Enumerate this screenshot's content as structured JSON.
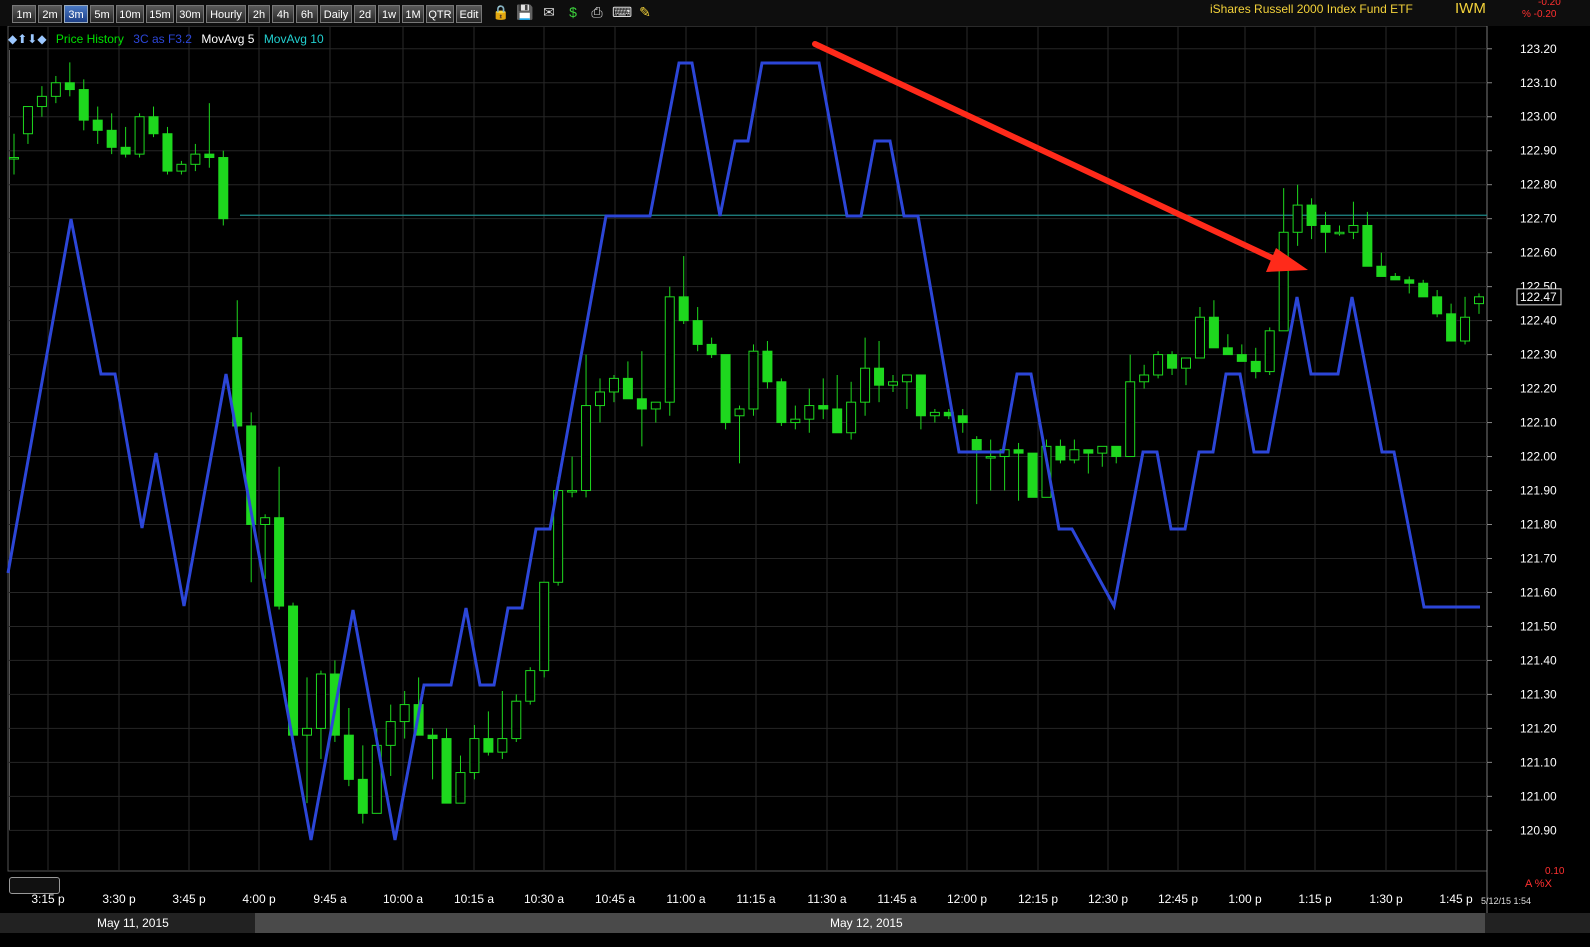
{
  "toolbar": {
    "timeframes": [
      "1m",
      "2m",
      "3m",
      "5m",
      "10m",
      "15m",
      "30m",
      "Hourly",
      "2h",
      "4h",
      "6h",
      "Daily",
      "2d",
      "1w",
      "1M",
      "QTR",
      "Edit"
    ],
    "active": "3m",
    "icons": [
      "lock-icon",
      "save-icon",
      "mail-icon",
      "dollar-icon",
      "print-icon",
      "keyboard-icon",
      "pencil-icon"
    ]
  },
  "header": {
    "title": "iShares Russell 2000 Index Fund ETF",
    "ticker": "IWM",
    "change": "-0.20",
    "change_pct": "% -0.20"
  },
  "legend": {
    "arrows": "◆⬆⬇◆",
    "items": [
      {
        "label": "Price History",
        "color": "#00e000"
      },
      {
        "label": "3C as F3.2",
        "color": "#2c46d8"
      },
      {
        "label": "MovAvg 5",
        "color": "#ffffff"
      },
      {
        "label": "MovAvg 10",
        "color": "#22d0d0"
      }
    ]
  },
  "footer": {
    "date_left": "May 11, 2015",
    "date_right": "May 12, 2015",
    "timestamp": "5/12/15 1:54",
    "right_values": [
      "0.10",
      "A %X"
    ]
  },
  "chart_data": {
    "type": "candlestick",
    "title": "iShares Russell 2000 Index Fund ETF",
    "ylim": [
      120.82,
      123.25
    ],
    "y_ticks": [
      120.9,
      121.0,
      121.1,
      121.2,
      121.3,
      121.4,
      121.5,
      121.6,
      121.7,
      121.8,
      121.9,
      122.0,
      122.1,
      122.2,
      122.3,
      122.4,
      122.5,
      122.6,
      122.7,
      122.8,
      122.9,
      123.0,
      123.1,
      123.2
    ],
    "last_price": "122.47",
    "reference_line": 122.71,
    "x_labels": [
      "3:15 p",
      "3:30 p",
      "3:45 p",
      "4:00 p",
      "9:45 a",
      "10:00 a",
      "10:15 a",
      "10:30 a",
      "10:45 a",
      "11:00 a",
      "11:15 a",
      "11:30 a",
      "11:45 a",
      "12:00 p",
      "12:15 p",
      "12:30 p",
      "12:45 p",
      "1:00 p",
      "1:15 p",
      "1:30 p",
      "1:45 p"
    ],
    "candles": [
      [
        122.88,
        122.95,
        122.83,
        122.88
      ],
      [
        122.95,
        123.03,
        122.92,
        123.03
      ],
      [
        123.03,
        123.09,
        123.0,
        123.06
      ],
      [
        123.06,
        123.12,
        123.04,
        123.1
      ],
      [
        123.1,
        123.16,
        123.06,
        123.08
      ],
      [
        123.08,
        123.11,
        122.96,
        122.99
      ],
      [
        122.99,
        123.03,
        122.92,
        122.96
      ],
      [
        122.96,
        123.01,
        122.89,
        122.91
      ],
      [
        122.91,
        122.97,
        122.88,
        122.89
      ],
      [
        122.89,
        123.01,
        122.88,
        123.0
      ],
      [
        123.0,
        123.03,
        122.94,
        122.95
      ],
      [
        122.95,
        122.97,
        122.83,
        122.84
      ],
      [
        122.84,
        122.87,
        122.83,
        122.86
      ],
      [
        122.86,
        122.92,
        122.84,
        122.89
      ],
      [
        122.89,
        123.04,
        122.85,
        122.88
      ],
      [
        122.88,
        122.9,
        122.68,
        122.7
      ],
      [
        122.35,
        122.46,
        122.07,
        122.09
      ],
      [
        122.09,
        122.13,
        121.63,
        121.8
      ],
      [
        121.8,
        121.83,
        121.64,
        121.82
      ],
      [
        121.82,
        121.97,
        121.55,
        121.56
      ],
      [
        121.56,
        121.57,
        121.14,
        121.18
      ],
      [
        121.18,
        121.35,
        120.98,
        121.2
      ],
      [
        121.2,
        121.37,
        121.11,
        121.36
      ],
      [
        121.36,
        121.4,
        121.16,
        121.18
      ],
      [
        121.18,
        121.26,
        121.03,
        121.05
      ],
      [
        121.05,
        121.15,
        120.92,
        120.95
      ],
      [
        120.95,
        121.2,
        120.95,
        121.15
      ],
      [
        121.15,
        121.27,
        121.06,
        121.22
      ],
      [
        121.22,
        121.31,
        121.17,
        121.27
      ],
      [
        121.27,
        121.35,
        121.18,
        121.18
      ],
      [
        121.18,
        121.2,
        121.05,
        121.17
      ],
      [
        121.17,
        121.2,
        121.0,
        120.98
      ],
      [
        120.98,
        121.12,
        120.98,
        121.07
      ],
      [
        121.07,
        121.21,
        121.05,
        121.17
      ],
      [
        121.17,
        121.25,
        121.12,
        121.13
      ],
      [
        121.13,
        121.31,
        121.11,
        121.17
      ],
      [
        121.17,
        121.3,
        121.16,
        121.28
      ],
      [
        121.28,
        121.38,
        121.27,
        121.37
      ],
      [
        121.37,
        121.63,
        121.35,
        121.63
      ],
      [
        121.63,
        121.94,
        121.62,
        121.9
      ],
      [
        121.9,
        122.0,
        121.88,
        121.9
      ],
      [
        121.9,
        122.3,
        121.88,
        122.15
      ],
      [
        122.15,
        122.23,
        122.1,
        122.19
      ],
      [
        122.19,
        122.24,
        122.16,
        122.23
      ],
      [
        122.23,
        122.28,
        122.17,
        122.17
      ],
      [
        122.17,
        122.31,
        122.03,
        122.14
      ],
      [
        122.14,
        122.16,
        122.1,
        122.16
      ],
      [
        122.16,
        122.5,
        122.12,
        122.47
      ],
      [
        122.47,
        122.59,
        122.39,
        122.4
      ],
      [
        122.4,
        122.44,
        122.31,
        122.33
      ],
      [
        122.33,
        122.35,
        122.29,
        122.3
      ],
      [
        122.3,
        122.3,
        122.08,
        122.1
      ],
      [
        122.12,
        122.15,
        121.98,
        122.14
      ],
      [
        122.14,
        122.33,
        122.12,
        122.31
      ],
      [
        122.31,
        122.34,
        122.2,
        122.22
      ],
      [
        122.22,
        122.23,
        122.09,
        122.1
      ],
      [
        122.1,
        122.15,
        122.08,
        122.11
      ],
      [
        122.11,
        122.2,
        122.07,
        122.15
      ],
      [
        122.15,
        122.23,
        122.11,
        122.14
      ],
      [
        122.14,
        122.24,
        122.08,
        122.07
      ],
      [
        122.07,
        122.22,
        122.05,
        122.16
      ],
      [
        122.16,
        122.35,
        122.12,
        122.26
      ],
      [
        122.26,
        122.34,
        122.16,
        122.21
      ],
      [
        122.21,
        122.24,
        122.19,
        122.22
      ],
      [
        122.22,
        122.24,
        122.14,
        122.24
      ],
      [
        122.24,
        122.23,
        122.08,
        122.12
      ],
      [
        122.12,
        122.14,
        122.1,
        122.13
      ],
      [
        122.13,
        122.14,
        122.11,
        122.12
      ],
      [
        122.12,
        122.14,
        122.07,
        122.1
      ],
      [
        122.05,
        122.06,
        121.86,
        122.02
      ],
      [
        122.0,
        122.05,
        121.9,
        122.0
      ],
      [
        122.0,
        122.04,
        121.9,
        122.02
      ],
      [
        122.02,
        122.04,
        121.87,
        122.01
      ],
      [
        122.01,
        122.0,
        121.88,
        121.88
      ],
      [
        121.88,
        122.05,
        121.88,
        122.03
      ],
      [
        122.03,
        122.05,
        121.98,
        121.99
      ],
      [
        121.99,
        122.05,
        121.98,
        122.02
      ],
      [
        122.02,
        122.02,
        121.95,
        122.01
      ],
      [
        122.01,
        122.03,
        121.97,
        122.03
      ],
      [
        122.03,
        122.03,
        121.98,
        122.0
      ],
      [
        122.0,
        122.3,
        122.0,
        122.22
      ],
      [
        122.22,
        122.27,
        122.2,
        122.24
      ],
      [
        122.24,
        122.31,
        122.23,
        122.3
      ],
      [
        122.3,
        122.31,
        122.24,
        122.26
      ],
      [
        122.26,
        122.29,
        122.21,
        122.29
      ],
      [
        122.29,
        122.44,
        122.29,
        122.41
      ],
      [
        122.41,
        122.46,
        122.32,
        122.32
      ],
      [
        122.32,
        122.36,
        122.3,
        122.3
      ],
      [
        122.3,
        122.33,
        122.28,
        122.28
      ],
      [
        122.28,
        122.32,
        122.23,
        122.25
      ],
      [
        122.25,
        122.38,
        122.24,
        122.37
      ],
      [
        122.37,
        122.79,
        122.37,
        122.66
      ],
      [
        122.66,
        122.8,
        122.62,
        122.74
      ],
      [
        122.74,
        122.76,
        122.64,
        122.68
      ],
      [
        122.68,
        122.72,
        122.6,
        122.66
      ],
      [
        122.66,
        122.68,
        122.65,
        122.66
      ],
      [
        122.66,
        122.75,
        122.64,
        122.68
      ],
      [
        122.68,
        122.72,
        122.56,
        122.56
      ],
      [
        122.56,
        122.6,
        122.53,
        122.53
      ],
      [
        122.53,
        122.54,
        122.52,
        122.52
      ],
      [
        122.52,
        122.53,
        122.48,
        122.51
      ],
      [
        122.51,
        122.52,
        122.47,
        122.47
      ],
      [
        122.47,
        122.49,
        122.41,
        122.42
      ],
      [
        122.42,
        122.45,
        122.34,
        122.34
      ],
      [
        122.34,
        122.47,
        122.33,
        122.41
      ],
      [
        122.45,
        122.48,
        122.42,
        122.47
      ]
    ],
    "series": [
      {
        "name": "3C as F3.2",
        "line_color": "#2c46d8",
        "points": [
          [
            8,
            573
          ],
          [
            71,
            219
          ],
          [
            101,
            374
          ],
          [
            115,
            374
          ],
          [
            142,
            528
          ],
          [
            156,
            453
          ],
          [
            184,
            606
          ],
          [
            226,
            374
          ],
          [
            311,
            840
          ],
          [
            353,
            610
          ],
          [
            395,
            840
          ],
          [
            424,
            685
          ],
          [
            451,
            685
          ],
          [
            466,
            608
          ],
          [
            480,
            685
          ],
          [
            494,
            685
          ],
          [
            508,
            608
          ],
          [
            522,
            608
          ],
          [
            536,
            529
          ],
          [
            550,
            529
          ],
          [
            606,
            216
          ],
          [
            650,
            216
          ],
          [
            679,
            63
          ],
          [
            692,
            63
          ],
          [
            720,
            216
          ],
          [
            735,
            141
          ],
          [
            748,
            141
          ],
          [
            762,
            63
          ],
          [
            819,
            63
          ],
          [
            847,
            216
          ],
          [
            861,
            216
          ],
          [
            875,
            141
          ],
          [
            890,
            141
          ],
          [
            904,
            216
          ],
          [
            918,
            216
          ],
          [
            959,
            452
          ],
          [
            1003,
            452
          ],
          [
            1017,
            374
          ],
          [
            1031,
            374
          ],
          [
            1059,
            529
          ],
          [
            1072,
            529
          ],
          [
            1114,
            606
          ],
          [
            1143,
            452
          ],
          [
            1157,
            452
          ],
          [
            1171,
            529
          ],
          [
            1185,
            529
          ],
          [
            1199,
            452
          ],
          [
            1213,
            452
          ],
          [
            1226,
            374
          ],
          [
            1240,
            374
          ],
          [
            1254,
            452
          ],
          [
            1268,
            452
          ],
          [
            1297,
            297
          ],
          [
            1311,
            374
          ],
          [
            1338,
            374
          ],
          [
            1352,
            297
          ],
          [
            1382,
            452
          ],
          [
            1394,
            452
          ],
          [
            1424,
            607
          ],
          [
            1480,
            607
          ]
        ]
      }
    ],
    "annotation": "red trend arrow from 3C peak (11:30 a) toward price high near 1:15 p"
  }
}
